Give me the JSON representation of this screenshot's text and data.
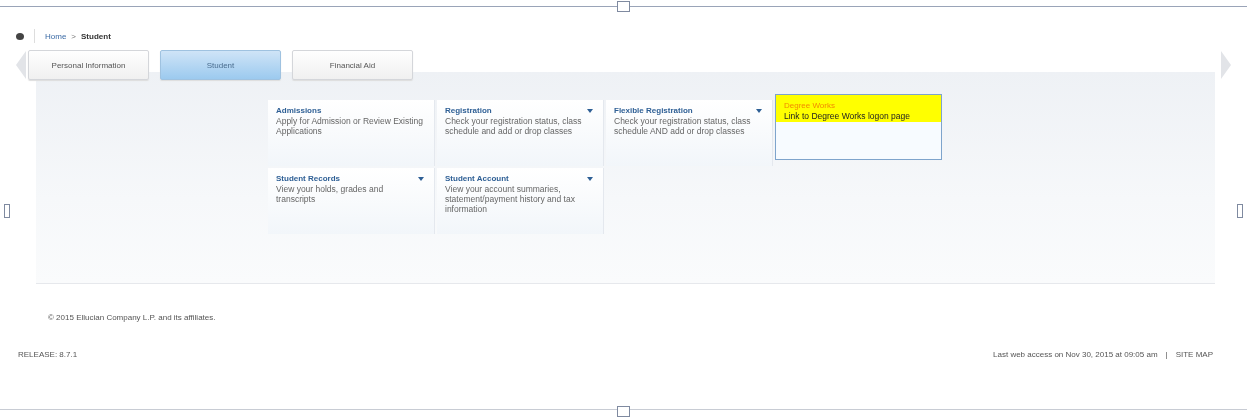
{
  "breadcrumb": {
    "items": [
      "Home",
      "Student"
    ],
    "separator": ">"
  },
  "tabs": [
    {
      "label": "Personal Information",
      "selected": false
    },
    {
      "label": "Student",
      "selected": true
    },
    {
      "label": "Financial Aid",
      "selected": false
    }
  ],
  "cards": [
    {
      "title": "Admissions",
      "description": "Apply for Admission or Review Existing Applications",
      "dropdown": false,
      "highlighted": false
    },
    {
      "title": "Registration",
      "description": "Check your registration status, class schedule and add or drop classes",
      "dropdown": true,
      "highlighted": false
    },
    {
      "title": "Flexible Registration",
      "description": "Check your registration status, class schedule AND add or drop classes",
      "dropdown": true,
      "highlighted": false
    },
    {
      "title": "Degree Works",
      "description": "Link to Degree Works logon page",
      "dropdown": false,
      "highlighted": true
    },
    {
      "title": "Student Records",
      "description": "View your holds, grades and transcripts",
      "dropdown": true,
      "highlighted": false
    },
    {
      "title": "Student Account",
      "description": "View your account summaries, statement/payment history and tax information",
      "dropdown": true,
      "highlighted": false
    }
  ],
  "copyright": "© 2015 Ellucian Company L.P. and its affiliates.",
  "footer": {
    "release": "RELEASE: 8.7.1",
    "last_access": "Last web access on Nov 30, 2015 at 09:05 am",
    "separator": "|",
    "site_map": "SITE MAP"
  }
}
